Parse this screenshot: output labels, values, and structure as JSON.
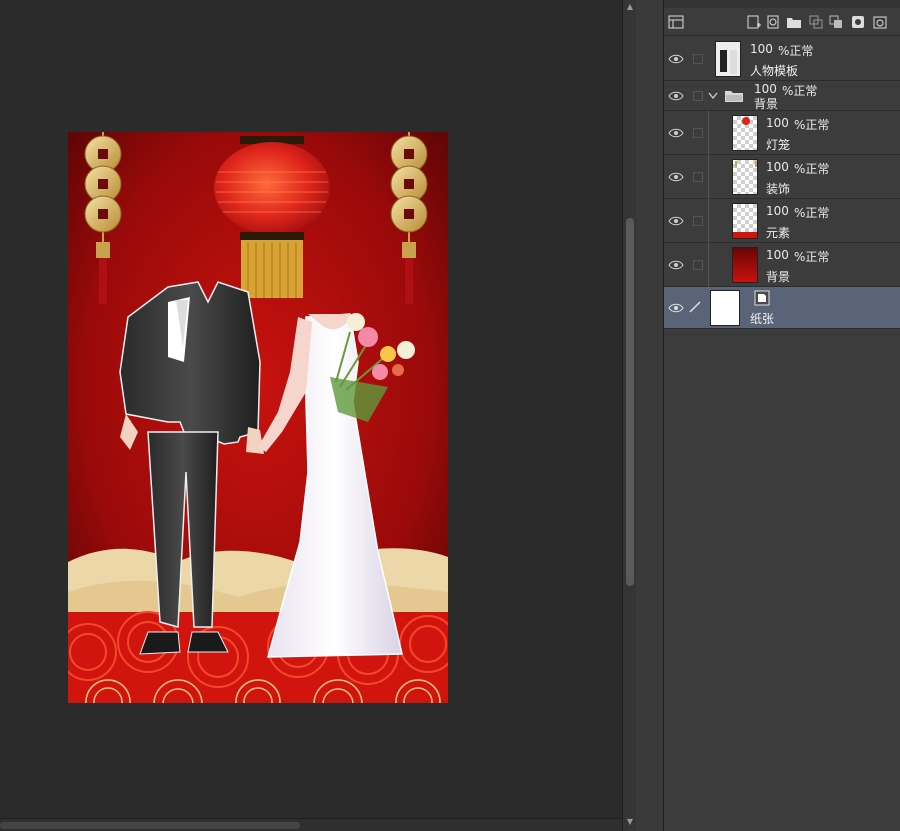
{
  "layers_panel": {
    "layers": [
      {
        "id": "figure-template",
        "opacity": "100",
        "mode": "%正常",
        "name": "人物模板",
        "type": "raster",
        "selected": false
      },
      {
        "id": "background-folder",
        "opacity": "100",
        "mode": "%正常",
        "name": "背景",
        "type": "folder",
        "expanded": true,
        "selected": false
      },
      {
        "id": "lantern",
        "opacity": "100",
        "mode": "%正常",
        "name": "灯笼",
        "type": "raster",
        "selected": false
      },
      {
        "id": "decoration",
        "opacity": "100",
        "mode": "%正常",
        "name": "装饰",
        "type": "raster",
        "selected": false
      },
      {
        "id": "elements",
        "opacity": "100",
        "mode": "%正常",
        "name": "元素",
        "type": "raster",
        "selected": false
      },
      {
        "id": "background",
        "opacity": "100",
        "mode": "%正常",
        "name": "背景",
        "type": "raster",
        "selected": false
      },
      {
        "id": "paper",
        "name": "纸张",
        "type": "paper",
        "selected": true
      }
    ]
  },
  "colors": {
    "selected_row": "#5a6478",
    "panel_bg": "#3c3c3c",
    "workspace_bg": "#2b2b2b",
    "poster_red": "#b30d0d",
    "lantern_red": "#e0261c",
    "gold": "#d9b45a"
  },
  "icons": {
    "visibility": "eye-icon",
    "folder": "folder-icon",
    "pen": "pen-icon",
    "paper": "paper-icon",
    "expand": "chevron-down-icon"
  }
}
